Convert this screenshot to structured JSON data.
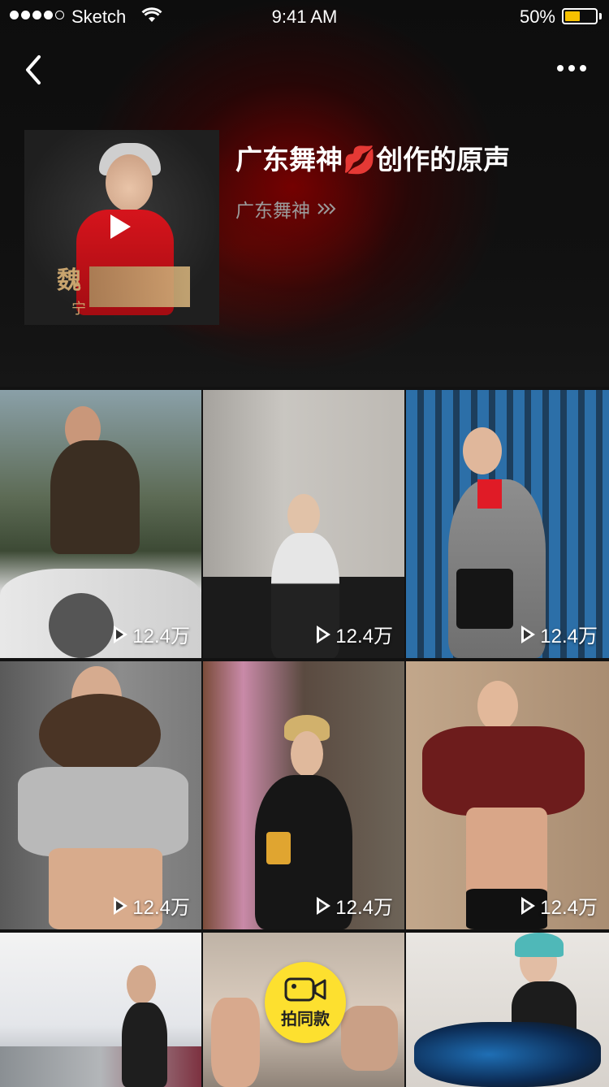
{
  "status_bar": {
    "carrier": "Sketch",
    "time": "9:41 AM",
    "battery_percent": "50%",
    "battery_level": 0.5
  },
  "header": {
    "back_icon": "chevron-left-icon",
    "more_icon": "more-horizontal-icon"
  },
  "music": {
    "title": "广东舞神💋创作的原声",
    "author": "广东舞神",
    "author_arrow_icon": "triple-chevron-right-icon"
  },
  "videos": [
    {
      "play_count": "12.4万"
    },
    {
      "play_count": "12.4万"
    },
    {
      "play_count": "12.4万"
    },
    {
      "play_count": "12.4万"
    },
    {
      "play_count": "12.4万"
    },
    {
      "play_count": "12.4万"
    }
  ],
  "shoot_button": {
    "label": "拍同款",
    "icon": "video-camera-icon"
  },
  "colors": {
    "accent_yellow": "#fde02f",
    "battery_fill": "#f7c100",
    "background": "#121212",
    "secondary_text": "#9b9b9b"
  }
}
